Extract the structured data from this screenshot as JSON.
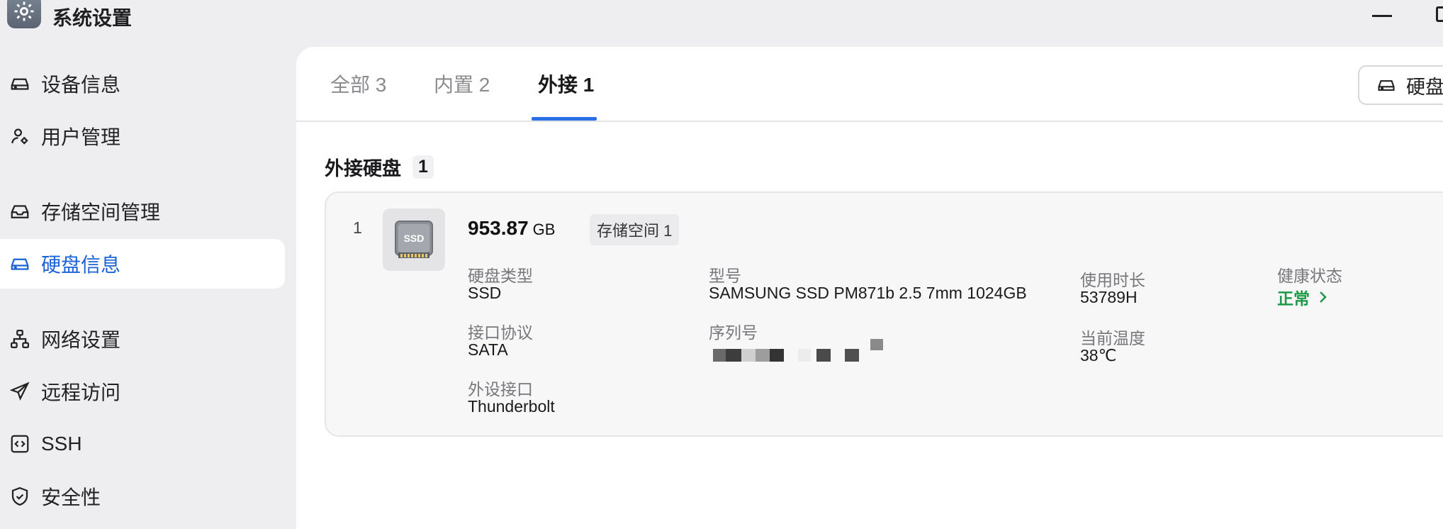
{
  "window": {
    "title": "系统设置",
    "icon": "gear-icon"
  },
  "sidebar": {
    "items": [
      {
        "label": "设备信息",
        "icon": "drive-icon"
      },
      {
        "label": "用户管理",
        "icon": "user-settings-icon"
      },
      {
        "label": "存储空间管理",
        "icon": "inbox-storage-icon"
      },
      {
        "label": "硬盘信息",
        "icon": "drive-icon",
        "active": true
      },
      {
        "label": "网络设置",
        "icon": "network-icon"
      },
      {
        "label": "远程访问",
        "icon": "send-icon"
      },
      {
        "label": "SSH",
        "icon": "code-terminal-icon"
      },
      {
        "label": "安全性",
        "icon": "shield-check-icon"
      }
    ]
  },
  "tabs": [
    {
      "label": "全部 3"
    },
    {
      "label": "内置 2"
    },
    {
      "label": "外接 1",
      "active": true
    }
  ],
  "toolbar": {
    "disk_button_label": "硬盘"
  },
  "section": {
    "title": "外接硬盘",
    "count": "1"
  },
  "disk": {
    "index": "1",
    "capacity_value": "953.87",
    "capacity_unit": "GB",
    "pool_tag": "存储空间 1",
    "thumb_label": "SSD",
    "fields": {
      "type_label": "硬盘类型",
      "type_value": "SSD",
      "protocol_label": "接口协议",
      "protocol_value": "SATA",
      "port_label": "外设接口",
      "port_value": "Thunderbolt",
      "model_label": "型号",
      "model_value": "SAMSUNG SSD PM871b 2.5 7mm 1024GB",
      "serial_label": "序列号",
      "uptime_label": "使用时长",
      "uptime_value": "53789H",
      "temp_label": "当前温度",
      "temp_value": "38℃",
      "health_label": "健康状态",
      "health_value": "正常"
    }
  },
  "colors": {
    "accent": "#2a6ee8",
    "active_text": "#1b63d8",
    "health_ok": "#1f9a49",
    "sidebar_bg": "#eeeef0",
    "panel_bg": "#ffffff"
  }
}
